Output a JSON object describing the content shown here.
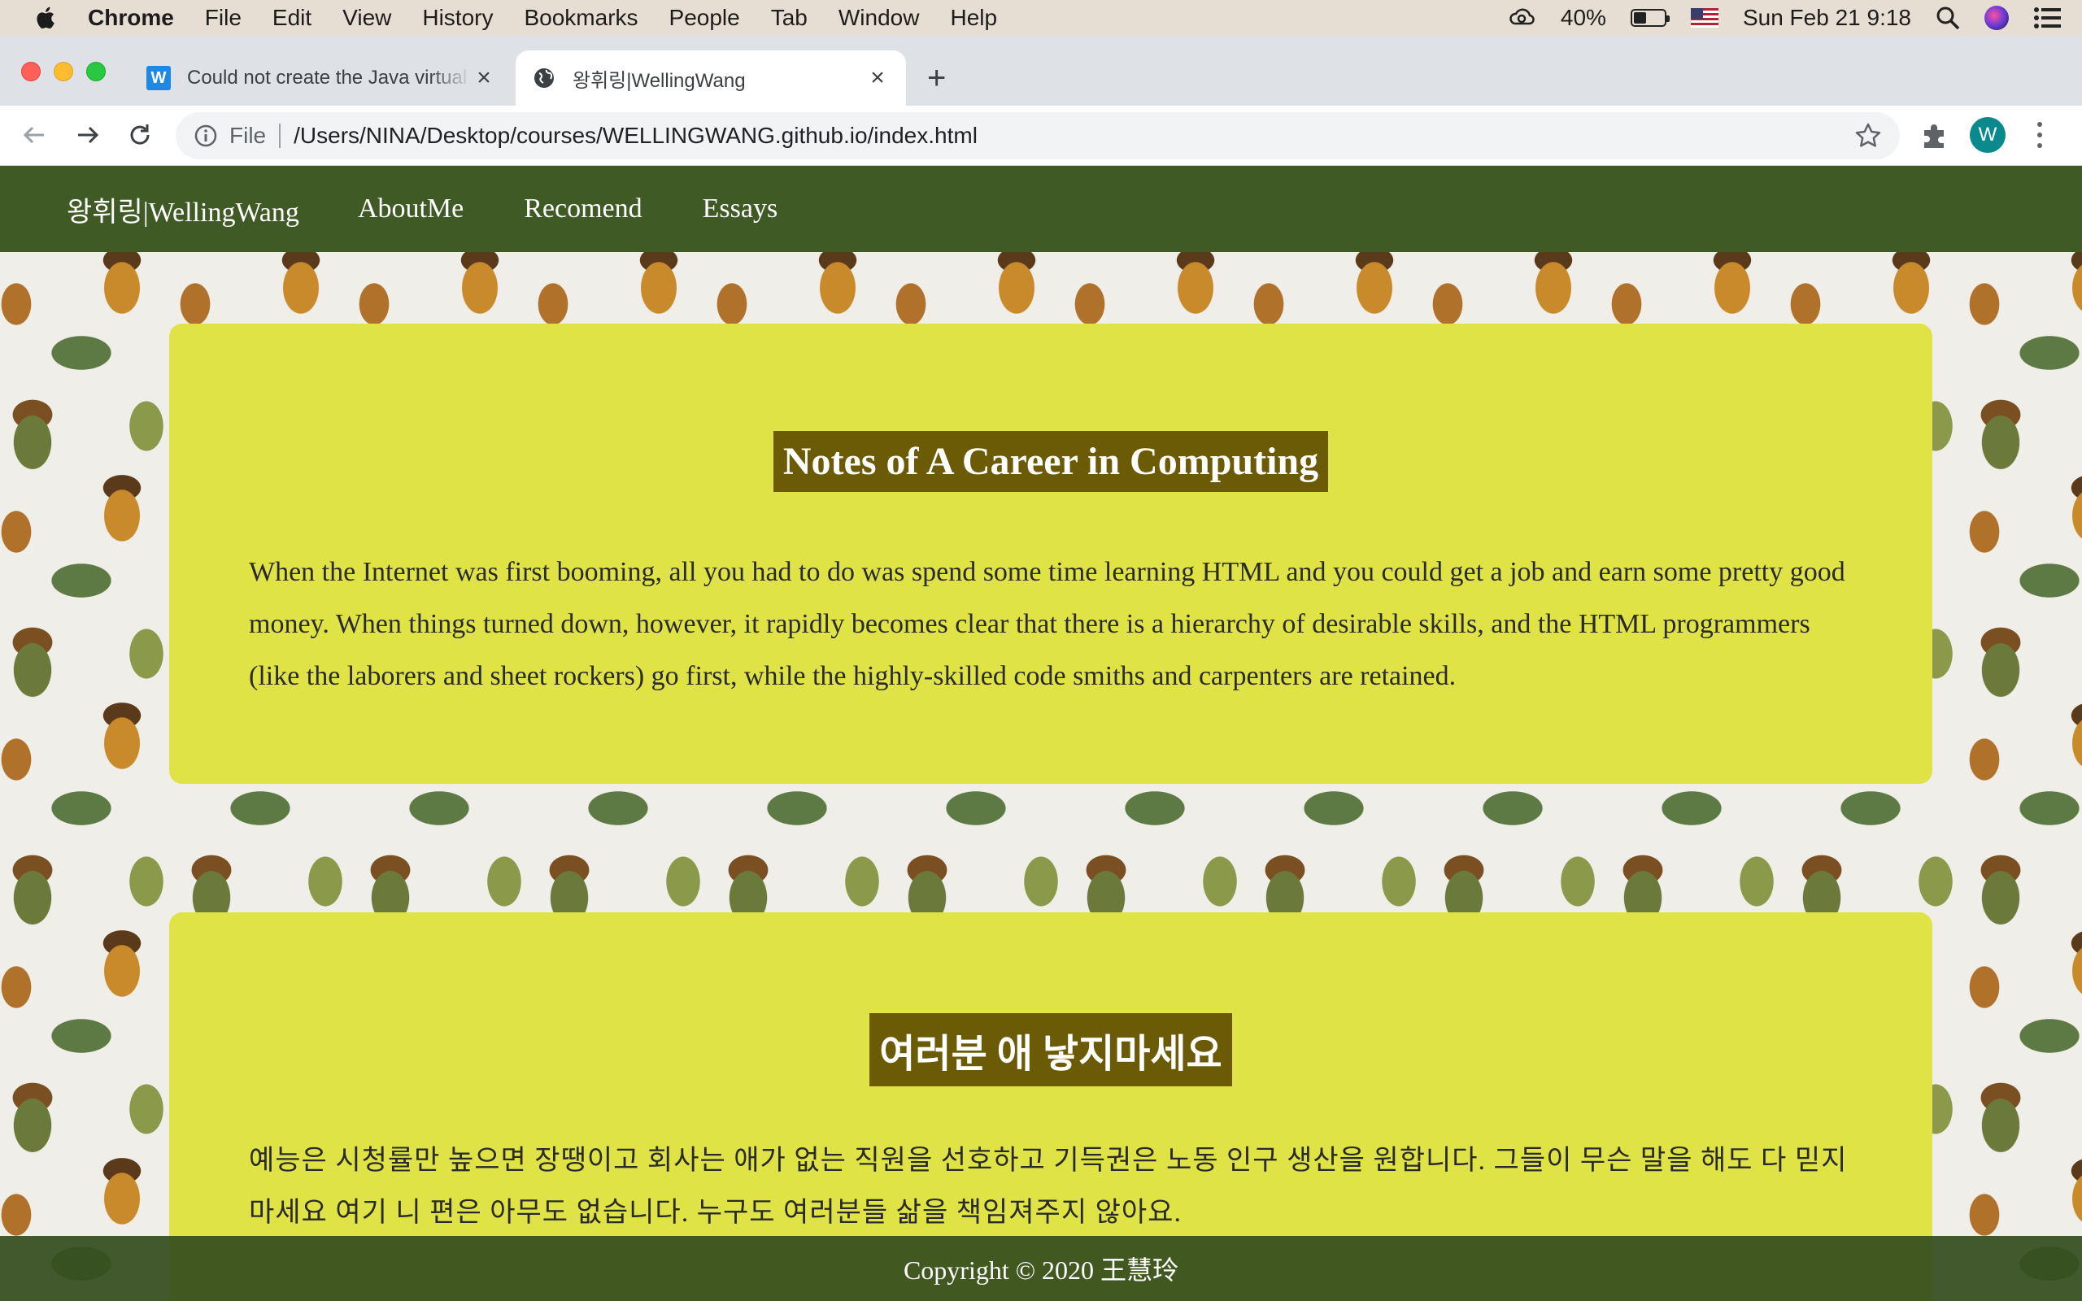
{
  "menubar": {
    "app": "Chrome",
    "items": [
      "File",
      "Edit",
      "View",
      "History",
      "Bookmarks",
      "People",
      "Tab",
      "Window",
      "Help"
    ],
    "battery_percent": "40%",
    "battery_level": 0.4,
    "datetime": "Sun Feb 21  9:18"
  },
  "tabs": [
    {
      "title": "Could not create the Java virtual machine",
      "favicon": "W",
      "active": false
    },
    {
      "title": "왕휘링|WellingWang",
      "favicon": "globe-icon",
      "active": true
    }
  ],
  "toolbar": {
    "scheme": "File",
    "url": "/Users/NINA/Desktop/courses/WELLINGWANG.github.io/index.html",
    "profile_initial": "W"
  },
  "site": {
    "nav": {
      "brand": "왕휘링|WellingWang",
      "links": [
        "AboutMe",
        "Recomend",
        "Essays"
      ]
    },
    "cards": [
      {
        "title": "Notes of A Career in Computing",
        "body": "When the Internet was first booming, all you had to do was spend some time learning HTML and you could get a job and earn some pretty good money. When things turned down, however, it rapidly becomes clear that there is a hierarchy of desirable skills, and the HTML programmers (like the laborers and sheet rockers) go first, while the highly-skilled code smiths and carpenters are retained."
      },
      {
        "title": "여러분 애 낳지마세요",
        "body": "예능은 시청률만 높으면 장땡이고 회사는 애가 없는 직원을 선호하고 기득권은 노동 인구 생산을 원합니다. 그들이 무슨 말을 해도 다 믿지 마세요 여기 니 편은 아무도 없습니다. 누구도 여러분들 삶을 책임져주지 않아요."
      }
    ],
    "footer": "Copyright © 2020 王慧玲"
  },
  "colors": {
    "nav_bg": "#3f5a25",
    "card_bg": "#dfe346",
    "title_bg": "#6b5a06"
  }
}
